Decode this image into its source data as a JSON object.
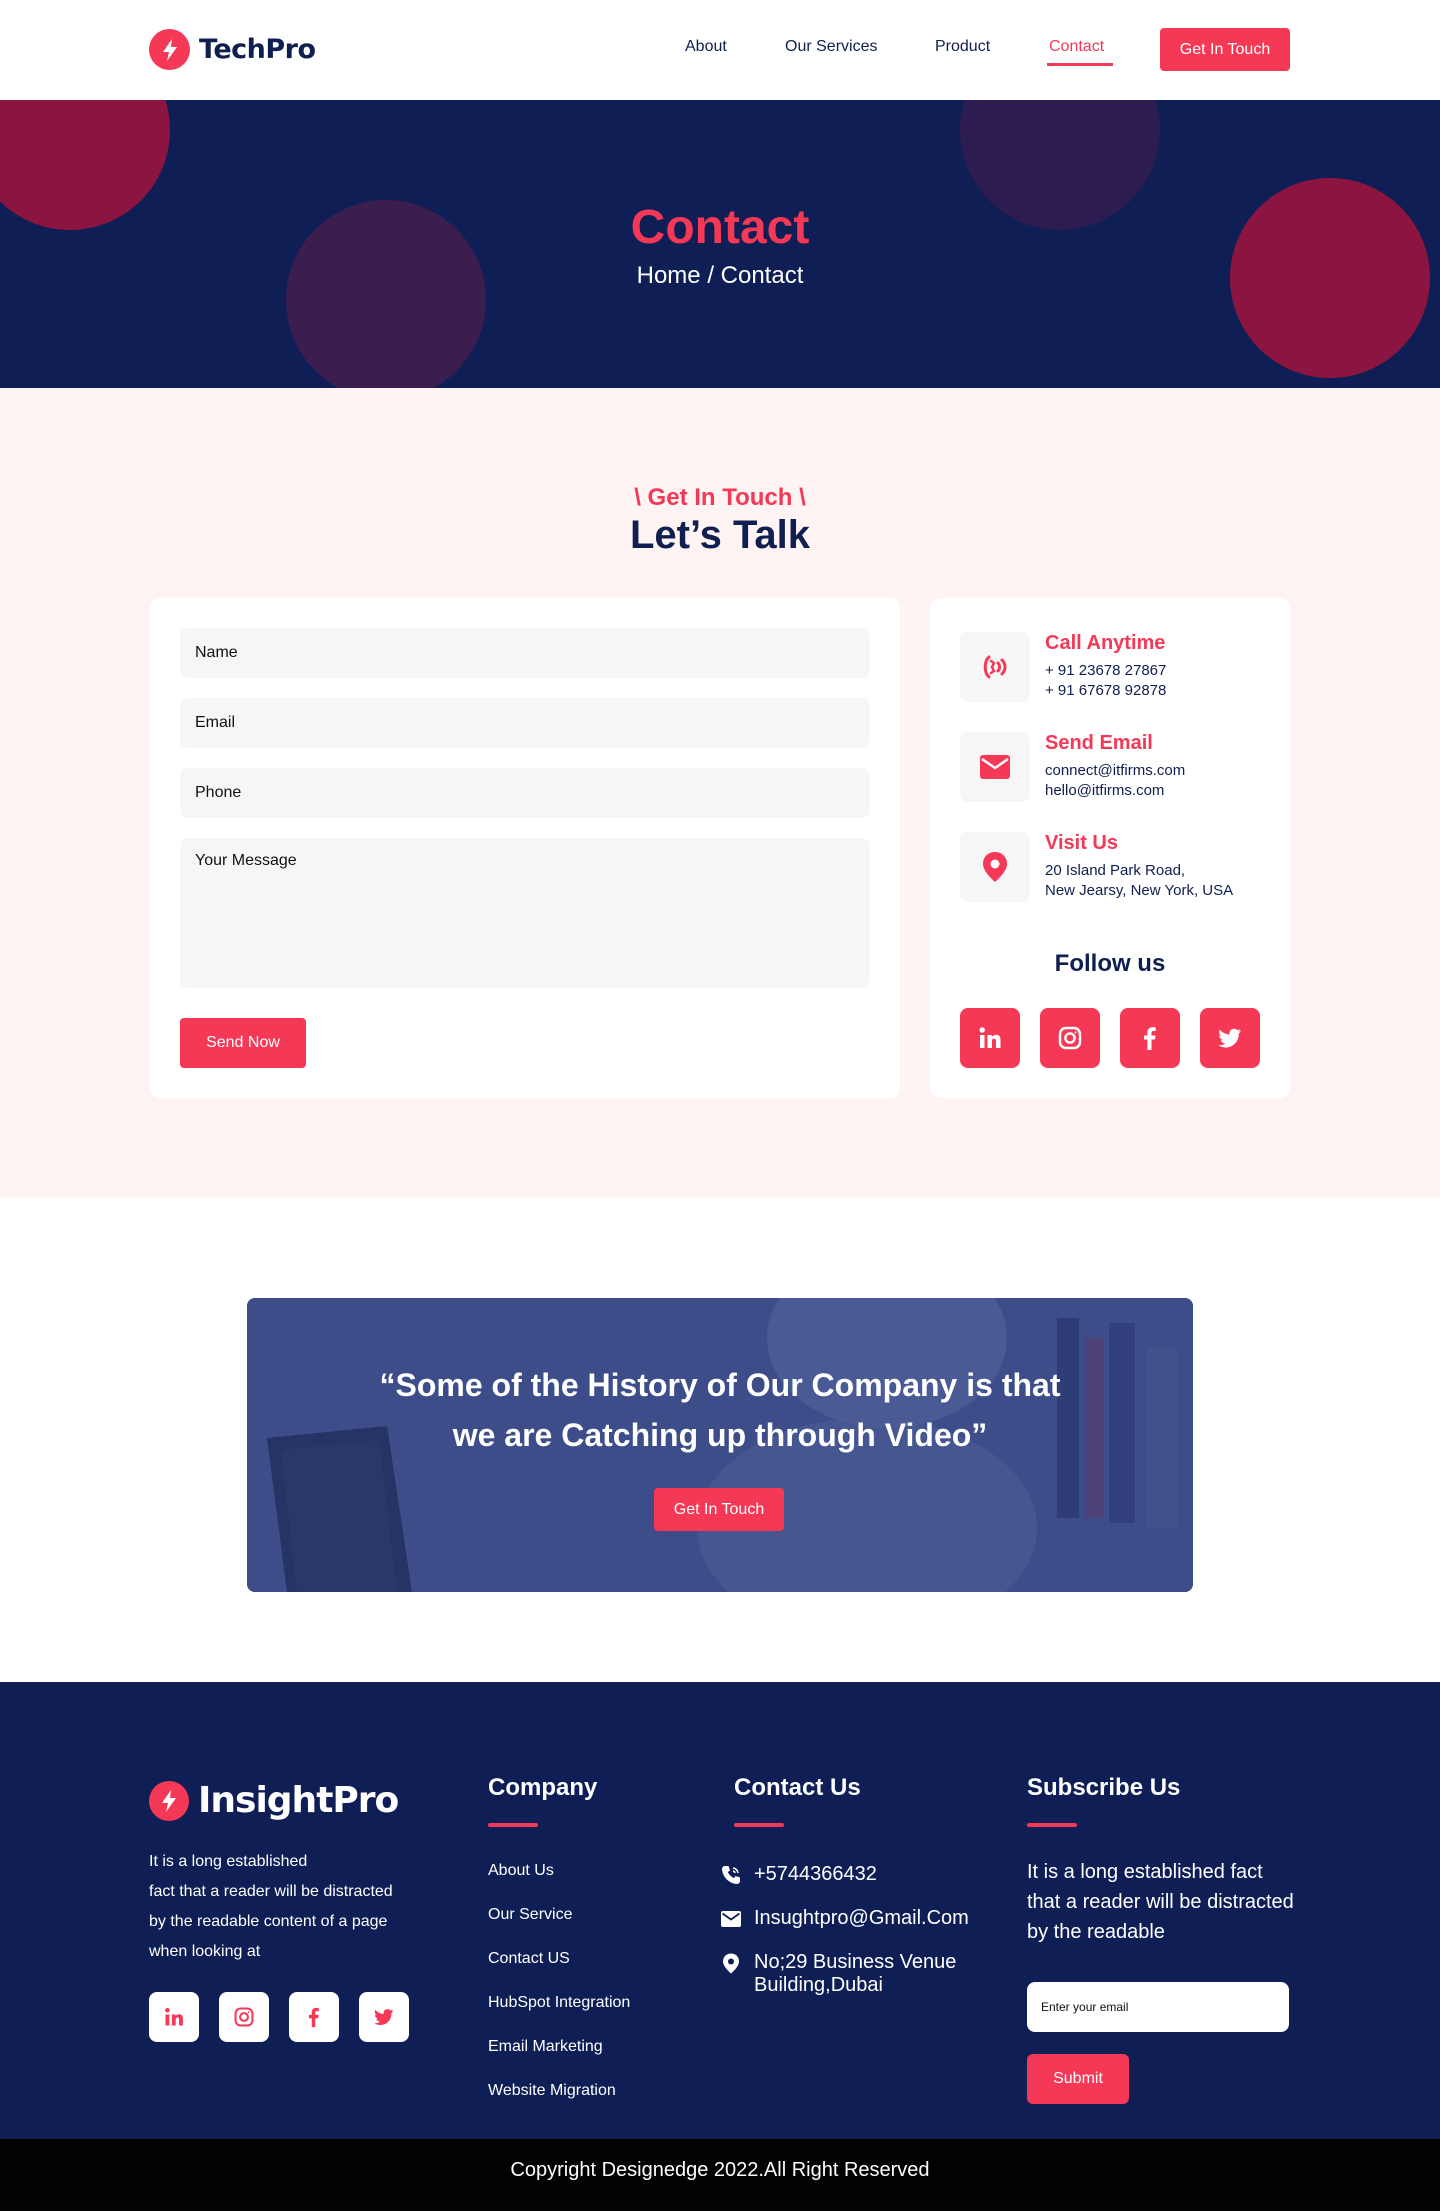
{
  "header": {
    "logo_text": "TechPro",
    "nav": [
      {
        "label": "About"
      },
      {
        "label": "Our Services"
      },
      {
        "label": "Product"
      },
      {
        "label": "Contact",
        "active": true
      }
    ],
    "cta_label": "Get In Touch"
  },
  "hero": {
    "title": "Contact",
    "breadcrumb": "Home / Contact"
  },
  "contact": {
    "kicker": "\\ Get In Touch \\",
    "title": "Let’s Talk",
    "form": {
      "name_placeholder": "Name",
      "email_placeholder": "Email",
      "phone_placeholder": "Phone",
      "message_placeholder": "Your Message",
      "submit_label": "Send Now"
    },
    "info": [
      {
        "title": "Call Anytime",
        "icon": "phone-ringing-icon",
        "lines": [
          "+ 91 23678 27867",
          "+ 91 67678 92878"
        ]
      },
      {
        "title": "Send Email",
        "icon": "envelope-icon",
        "lines": [
          "connect@itfirms.com",
          "hello@itfirms.com"
        ]
      },
      {
        "title": "Visit Us",
        "icon": "location-pin-icon",
        "lines": [
          "20 Island Park Road,",
          "New Jearsy, New York, USA"
        ]
      }
    ],
    "follow_title": "Follow us",
    "social_icons": [
      "linkedin-icon",
      "instagram-icon",
      "facebook-icon",
      "twitter-icon"
    ]
  },
  "banner": {
    "quote_line1": "“Some of the History of Our Company is that",
    "quote_line2": "we are Catching up through Video”",
    "cta_label": "Get In Touch"
  },
  "footer": {
    "logo_text": "InsightPro",
    "about_lines": [
      "It is a long established",
      "fact that a reader will be distracted",
      "by the readable content of a page",
      "when looking at"
    ],
    "company_heading": "Company",
    "company_links": [
      "About Us",
      "Our Service",
      "Contact US",
      "HubSpot Integration",
      "Email Marketing",
      "Website Migration"
    ],
    "contact_heading": "Contact Us",
    "phone": "+5744366432",
    "email": "Insughtpro@Gmail.Com",
    "address_line1": "No;29 Business Venue",
    "address_line2": "Building,Dubai",
    "subscribe_heading": "Subscribe Us",
    "subscribe_text": "It is a long established fact that a reader will be distracted by the readable",
    "email_placeholder": "Enter your email",
    "submit_label": "Submit",
    "copyright": "Copyright Designedge 2022.All Right Reserved"
  },
  "colors": {
    "accent": "#f53855",
    "navy": "#0f1f55",
    "section_bg": "#fff4f4"
  }
}
